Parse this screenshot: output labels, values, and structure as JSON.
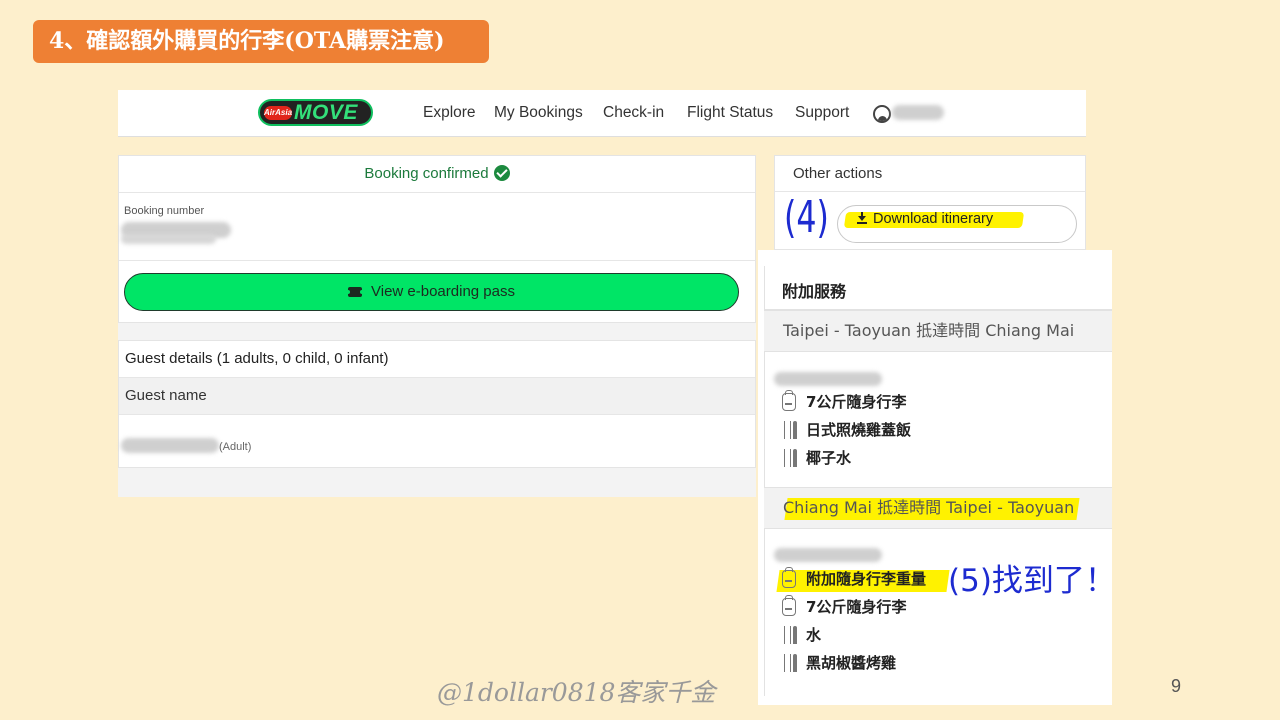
{
  "slide": {
    "title": "4、確認額外購買的行李(OTA購票注意)",
    "watermark": "@1dollar0818客家千金",
    "page_number": "9"
  },
  "navbar": {
    "logo_brand": "AirAsia",
    "logo_word": "MOVE",
    "items": [
      "Explore",
      "My Bookings",
      "Check-in",
      "Flight Status",
      "Support"
    ]
  },
  "booking": {
    "status": "Booking confirmed",
    "number_label": "Booking number",
    "eboarding_label": "View e-boarding pass"
  },
  "guests": {
    "title": "Guest details (1 adults, 0 child, 0 infant)",
    "name_header": "Guest name",
    "type": "(Adult)"
  },
  "other_actions": {
    "title": "Other actions",
    "download_label": "Download itinerary"
  },
  "annotations": {
    "step4": "(4)",
    "step5": "(5)找到了！"
  },
  "addons": {
    "title": "附加服務",
    "segments": [
      {
        "route": "Taipei - Taoyuan 抵達時間 Chiang Mai",
        "items": [
          "7公斤隨身行李",
          "日式照燒雞蓋飯",
          "椰子水"
        ]
      },
      {
        "route": "Chiang Mai 抵達時間 Taipei - Taoyuan",
        "items": [
          "附加隨身行李重量",
          "7公斤隨身行李",
          "水",
          "黑胡椒醬烤雞"
        ]
      }
    ]
  },
  "colors": {
    "background": "#fdefcc",
    "badge": "#ee8034",
    "eboarding_green": "#00e566",
    "highlight": "#fff200",
    "annotation_blue": "#1d2bd0"
  }
}
